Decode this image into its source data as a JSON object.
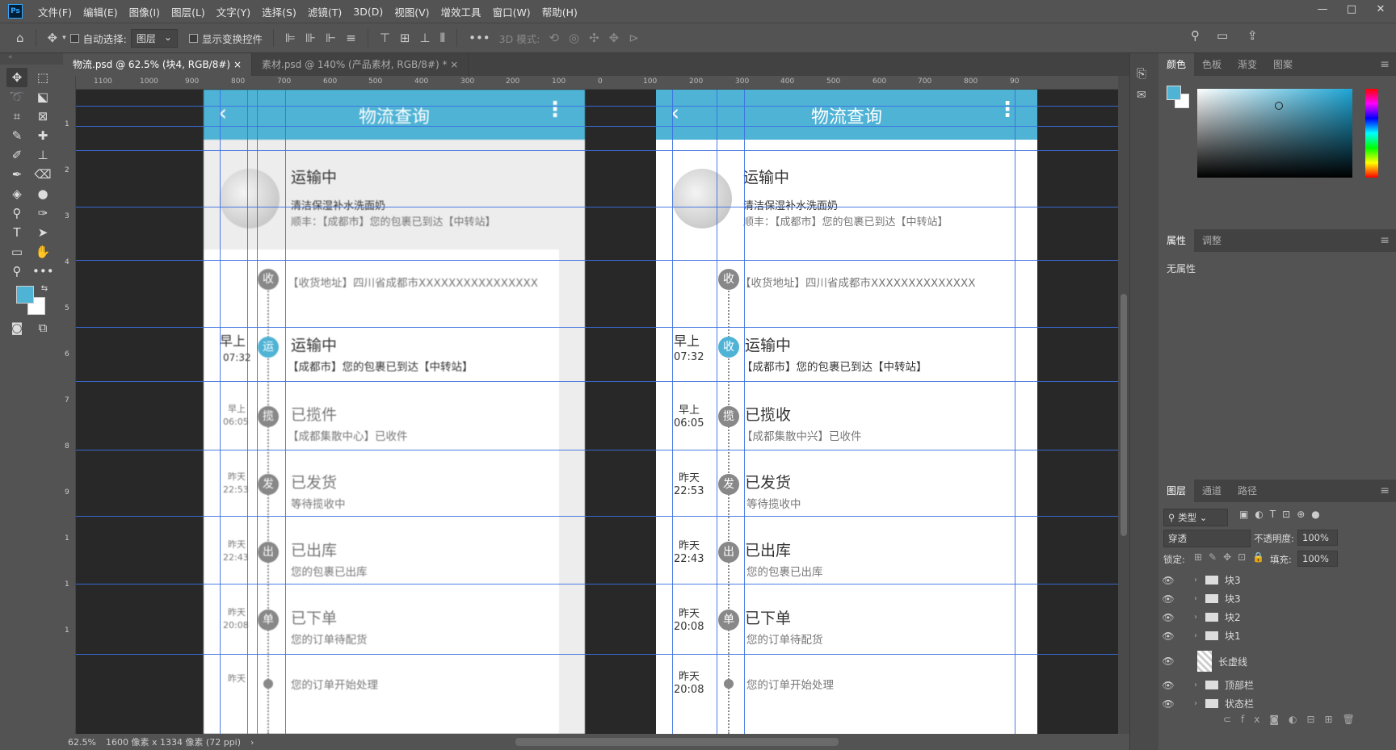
{
  "app": {
    "logo": "Ps"
  },
  "menu": [
    "文件(F)",
    "编辑(E)",
    "图像(I)",
    "图层(L)",
    "文字(Y)",
    "选择(S)",
    "滤镜(T)",
    "3D(D)",
    "视图(V)",
    "增效工具",
    "窗口(W)",
    "帮助(H)"
  ],
  "window_controls": [
    "—",
    "□",
    "✕"
  ],
  "options": {
    "auto_select_label": "自动选择:",
    "auto_select_value": "图层",
    "show_transform_label": "显示变换控件",
    "mode_3d_label": "3D 模式:"
  },
  "tabs": [
    {
      "label": "物流.psd @ 62.5% (块4, RGB/8#)",
      "close": "×"
    },
    {
      "label": "素材.psd @ 140% (产品素材, RGB/8#) *",
      "close": "×"
    }
  ],
  "ruler_h": [
    "1100",
    "1000",
    "900",
    "800",
    "700",
    "600",
    "500",
    "400",
    "300",
    "200",
    "100",
    "0",
    "100",
    "200",
    "300",
    "400",
    "500",
    "600",
    "700",
    "800",
    "90"
  ],
  "ruler_v": [
    "1",
    "2",
    "3",
    "4",
    "5",
    "6",
    "7",
    "8",
    "9",
    "1",
    "1",
    "1"
  ],
  "phone": {
    "title": "物流查询",
    "back": "‹",
    "more": "⋮",
    "status": "运输中",
    "product": "清洁保湿补水洗面奶",
    "carrier_line": "顺丰：【成都市】您的包裹已到达【中转站】",
    "address_left": "【收货地址】四川省成都市XXXXXXXXXXXXXXXX",
    "address_right": "【收货地址】四川省成都市XXXXXXXXXXXXXX",
    "node_receive": "收",
    "events_left": [
      {
        "node": "运",
        "time1": "早上",
        "time2": "07:32",
        "title": "运输中",
        "desc": "【成都市】您的包裹已到达【中转站】"
      },
      {
        "node": "揽",
        "time1": "早上",
        "time2": "06:05",
        "title": "已揽件",
        "desc": "【成都集散中心】已收件"
      },
      {
        "node": "发",
        "time1": "昨天",
        "time2": "22:53",
        "title": "已发货",
        "desc": "等待揽收中"
      },
      {
        "node": "出",
        "time1": "昨天",
        "time2": "22:43",
        "title": "已出库",
        "desc": "您的包裹已出库"
      },
      {
        "node": "单",
        "time1": "昨天",
        "time2": "20:08",
        "title": "已下单",
        "desc": "您的订单待配货"
      },
      {
        "node": "",
        "time1": "昨天",
        "time2": "",
        "title": "",
        "desc": "您的订单开始处理"
      }
    ],
    "events_right": [
      {
        "node": "收",
        "time1": "早上",
        "time2": "07:32",
        "title": "运输中",
        "desc": "【成都市】您的包裹已到达【中转站】"
      },
      {
        "node": "揽",
        "time1": "早上",
        "time2": "06:05",
        "title": "已揽收",
        "desc": "【成都集散中兴】已收件"
      },
      {
        "node": "发",
        "time1": "昨天",
        "time2": "22:53",
        "title": "已发货",
        "desc": "等待揽收中"
      },
      {
        "node": "出",
        "time1": "昨天",
        "time2": "22:43",
        "title": "已出库",
        "desc": "您的包裹已出库"
      },
      {
        "node": "单",
        "time1": "昨天",
        "time2": "20:08",
        "title": "已下单",
        "desc": "您的订单待配货"
      },
      {
        "node": "",
        "time1": "昨天",
        "time2": "20:08",
        "title": "",
        "desc": "您的订单开始处理"
      }
    ]
  },
  "status_bar": {
    "zoom": "62.5%",
    "doc_info": "1600 像素 x 1334 像素 (72 ppi)",
    "arrow": "›"
  },
  "color_panel": {
    "tabs": [
      "颜色",
      "色板",
      "渐变",
      "图案"
    ],
    "fg": "#4fb3d5",
    "bg": "#ffffff"
  },
  "props_panel": {
    "tabs": [
      "属性",
      "调整"
    ],
    "empty": "无属性"
  },
  "layers_panel": {
    "tabs": [
      "图层",
      "通道",
      "路径"
    ],
    "filter": "类型",
    "blend": "穿透",
    "opacity_label": "不透明度:",
    "opacity": "100%",
    "lock_label": "锁定:",
    "fill_label": "填充:",
    "fill": "100%",
    "layers": [
      "块3",
      "块3",
      "块2",
      "块1",
      "长虚线",
      "顶部栏",
      "状态栏"
    ]
  },
  "colors": {
    "accent": "#4fb3d5",
    "guide": "#3a6fe0"
  }
}
